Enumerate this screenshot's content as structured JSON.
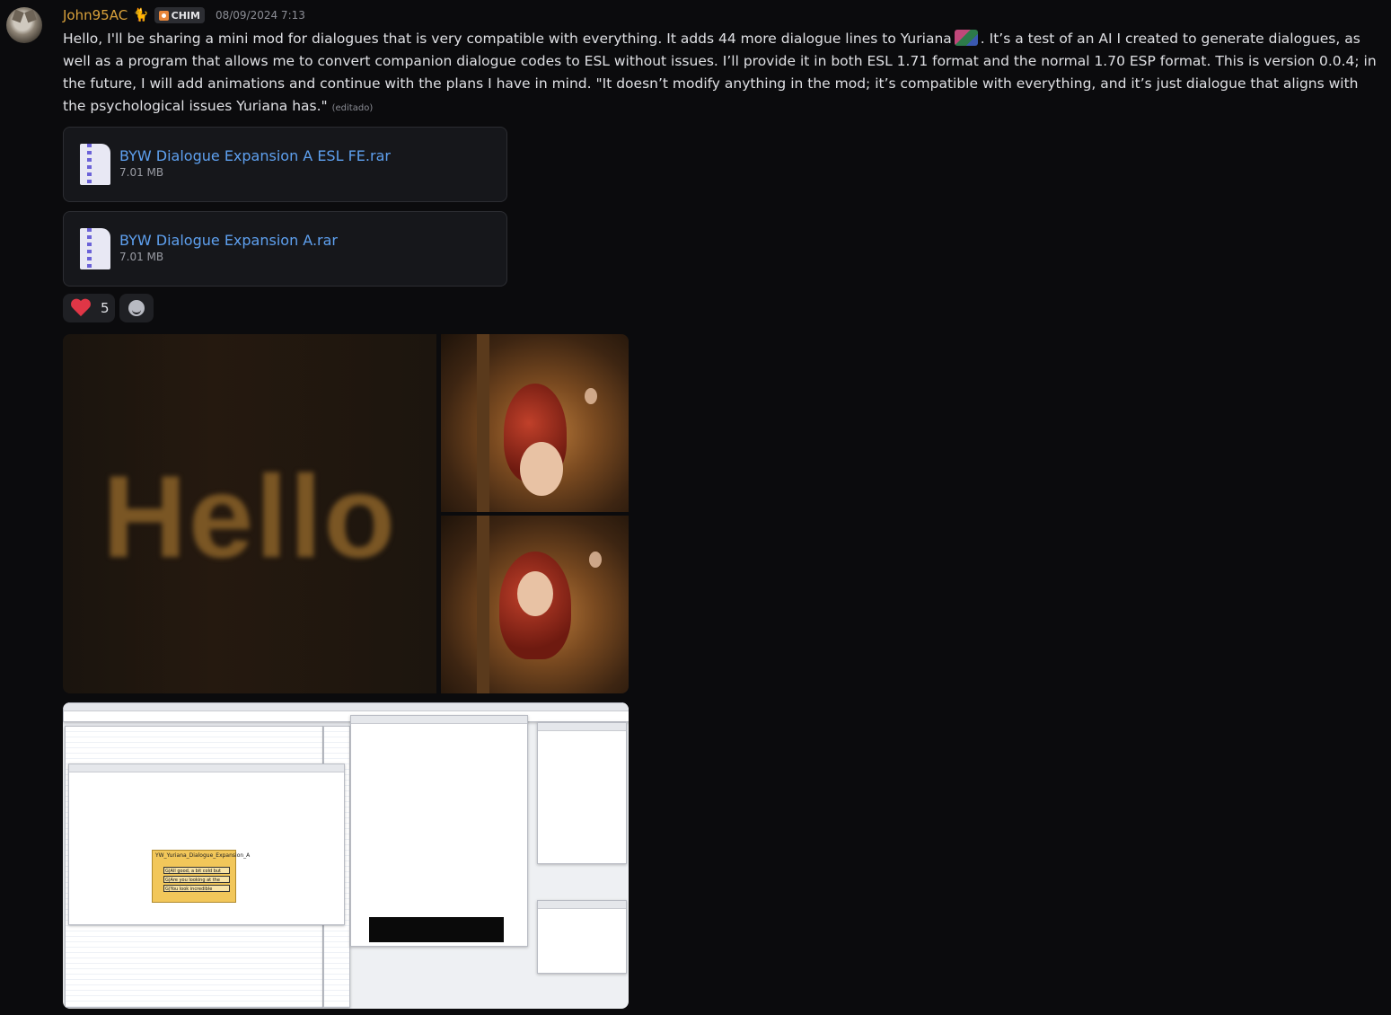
{
  "author": {
    "name": "John95AC",
    "role_tag": "CHIM",
    "timestamp": "08/09/2024 7:13",
    "avatar_icon": "cat-avatar"
  },
  "message": {
    "text": "Hello, I'll be sharing a mini mod for dialogues that is very compatible with everything. It adds 44 more dialogue lines to Yuriana",
    "text_after_emoji": ". It’s a test of an AI I created to generate dialogues, as well as a program that allows me to convert companion dialogue codes to ESL without issues. I’ll provide it in both ESL 1.71 format and the normal 1.70 ESP format. This is version 0.0.4; in the future, I will add animations and continue with the plans I have in mind. \"It doesn’t modify anything in the mod; it’s compatible with everything, and it’s just dialogue that aligns with the psychological issues Yuriana has.\"",
    "edited_label": "(editado)"
  },
  "attachments": [
    {
      "name": "BYW Dialogue Expansion A ESL FE.rar",
      "size": "7.01 MB",
      "icon": "zip-file-icon"
    },
    {
      "name": "BYW Dialogue Expansion A.rar",
      "size": "7.01 MB",
      "icon": "zip-file-icon"
    }
  ],
  "reactions": [
    {
      "emoji": "heart-icon",
      "count": "5"
    }
  ],
  "gif": {
    "text": "Hello"
  },
  "screenshot_note": {
    "title": "YW_Yuriana_Dialogue_Expansion_A",
    "lines": [
      "G|All good, a bit cold but",
      "G|Are you looking at the",
      "G|You look incredible"
    ]
  },
  "colors": {
    "background": "#0b0b0d",
    "username": "#d9a13b",
    "link": "#5ea0ef",
    "heart": "#e03646"
  }
}
